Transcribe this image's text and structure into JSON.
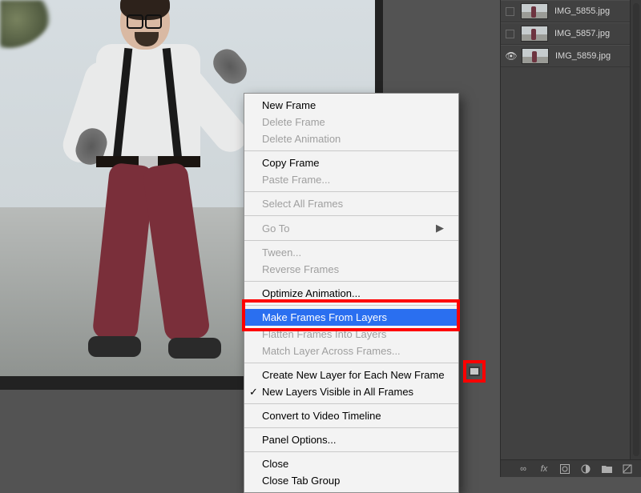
{
  "menu": {
    "new_frame": "New Frame",
    "delete_frame": "Delete Frame",
    "delete_animation": "Delete Animation",
    "copy_frame": "Copy Frame",
    "paste_frame": "Paste Frame...",
    "select_all_frames": "Select All Frames",
    "go_to": "Go To",
    "tween": "Tween...",
    "reverse_frames": "Reverse Frames",
    "optimize_animation": "Optimize Animation...",
    "make_frames_from_layers": "Make Frames From Layers",
    "flatten_frames_into_layers": "Flatten Frames Into Layers",
    "match_layer_across_frames": "Match Layer Across Frames...",
    "create_new_layer_each_frame": "Create New Layer for Each New Frame",
    "new_layers_visible_all_frames": "New Layers Visible in All Frames",
    "convert_to_video_timeline": "Convert to Video Timeline",
    "panel_options": "Panel Options...",
    "close": "Close",
    "close_tab_group": "Close Tab Group"
  },
  "layers": [
    {
      "name": "IMG_5855.jpg",
      "visible": false
    },
    {
      "name": "IMG_5857.jpg",
      "visible": false
    },
    {
      "name": "IMG_5859.jpg",
      "visible": true
    }
  ],
  "footer_icons": {
    "link": "∞",
    "fx": "fx"
  }
}
